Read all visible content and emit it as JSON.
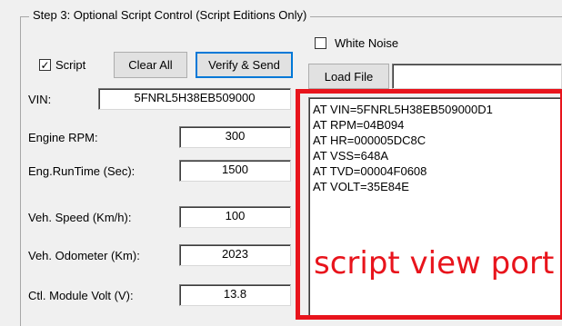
{
  "group_title": "Step 3: Optional Script Control (Script Editions Only)",
  "white_noise": {
    "label": "White Noise",
    "checked": false
  },
  "script_checkbox": {
    "label": "Script",
    "checked": true
  },
  "buttons": {
    "clear_all": "Clear All",
    "verify_send": "Verify & Send",
    "load_file": "Load File"
  },
  "file_path": "",
  "fields": [
    {
      "label": "VIN:",
      "value": "5FNRL5H38EB509000"
    },
    {
      "label": "Engine RPM:",
      "value": "300"
    },
    {
      "label": "Eng.RunTime (Sec):",
      "value": "1500"
    },
    {
      "label": "Veh. Speed (Km/h):",
      "value": "100"
    },
    {
      "label": "Veh. Odometer (Km):",
      "value": "2023"
    },
    {
      "label": "Ctl. Module Volt (V):",
      "value": "13.8"
    }
  ],
  "script_lines": [
    "AT VIN=5FNRL5H38EB509000D1",
    "AT RPM=04B094",
    "AT HR=000005DC8C",
    "AT VSS=648A",
    "AT TVD=00004F0608",
    "AT VOLT=35E84E"
  ],
  "annotation": "script view port",
  "colors": {
    "annotation": "#e8141c",
    "window_bg": "#f0f0f0"
  }
}
